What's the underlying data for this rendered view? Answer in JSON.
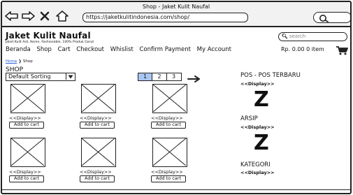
{
  "browser": {
    "title": "Shop - Jaket Kulit Naufal",
    "url": "https://jaketkulitindonesia.com/shop/"
  },
  "site": {
    "name": "Jaket Kulit Naufal",
    "tagline": "Jaket Kulit Asli, Keren, Fashionable, 100% Produk Garut",
    "search_placeholder": "search"
  },
  "menu": [
    "Beranda",
    "Shop",
    "Cart",
    "Checkout",
    "Whislist",
    "Confirm Payment",
    "My Account"
  ],
  "cart": {
    "summary": "Rp. 0.00  0 item"
  },
  "breadcrumb": {
    "home": "Home",
    "current": "Shop"
  },
  "shop": {
    "heading": "SHOP",
    "sort_value": "Default Sorting",
    "pages": [
      "1",
      "2",
      "3"
    ],
    "products": [
      {
        "display": "<<Display>>",
        "button": "Add to cart"
      },
      {
        "display": "<<Display>>",
        "button": "Add to cart"
      },
      {
        "display": "<<Display>>",
        "button": "Add to cart"
      },
      {
        "display": "<<Display>>",
        "button": "Add to cart"
      },
      {
        "display": "<<Display>>",
        "button": "Add to cart"
      },
      {
        "display": "<<Display>>",
        "button": "Add to cart"
      }
    ]
  },
  "sidebar": {
    "posts_title": "POS - POS TERBARU",
    "posts_display": "<<Display>>",
    "archive_title": "ARSIP",
    "archive_display": "<<Display>>",
    "category_title": "KATEGORI",
    "category_display": "<<Display>>",
    "placeholder_glyph": "Z"
  }
}
